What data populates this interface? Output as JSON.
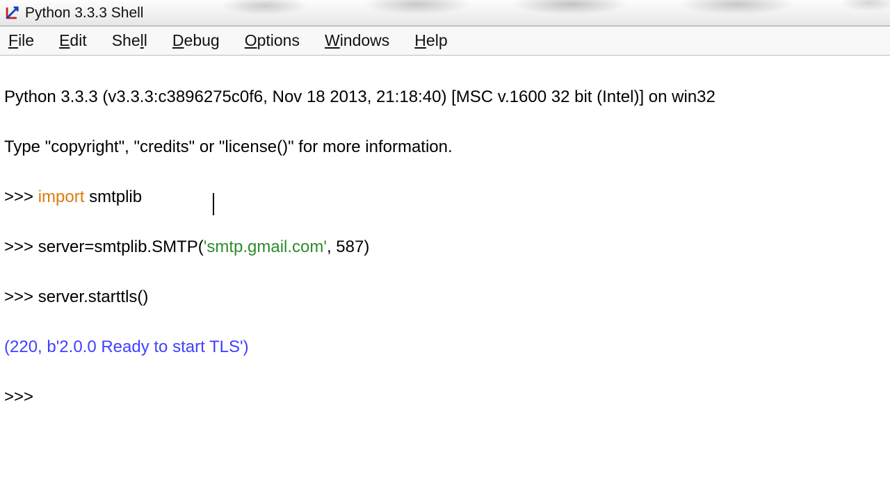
{
  "window": {
    "title": "Python 3.3.3 Shell"
  },
  "menu": {
    "file": "File",
    "edit": "Edit",
    "shell": "Shell",
    "debug": "Debug",
    "options": "Options",
    "windows": "Windows",
    "help": "Help"
  },
  "shell": {
    "banner1": "Python 3.3.3 (v3.3.3:c3896275c0f6, Nov 18 2013, 21:18:40) [MSC v.1600 32 bit (Intel)] on win32",
    "banner2": "Type \"copyright\", \"credits\" or \"license()\" for more information.",
    "prompt": ">>> ",
    "prompt_bare": ">>>",
    "line1_import": "import",
    "line1_rest": " smtplib",
    "line2_pre": "server=smtplib.SMTP(",
    "line2_str": "'smtp.gmail.com'",
    "line2_post": ", 587)",
    "line3": "server.starttls()",
    "output1": "(220, b'2.0.0 Ready to start TLS')"
  },
  "colors": {
    "keyword": "#d97d0d",
    "string": "#2e8b2e",
    "output": "#4040ff"
  }
}
